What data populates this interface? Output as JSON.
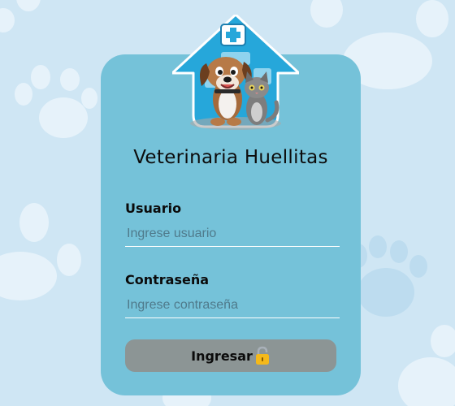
{
  "app": {
    "title": "Veterinaria Huellitas"
  },
  "login": {
    "username_label": "Usuario",
    "username_placeholder": "Ingrese usuario",
    "username_value": "",
    "password_label": "Contraseña",
    "password_placeholder": "Ingrese contraseña",
    "password_value": "",
    "submit_label": "Ingresar",
    "submit_icon": "lock-icon"
  },
  "theme": {
    "page_background": "#cfe6f4",
    "card_background": "#75c2d9",
    "button_background": "#8c9595",
    "logo_house": "#26a7da"
  }
}
